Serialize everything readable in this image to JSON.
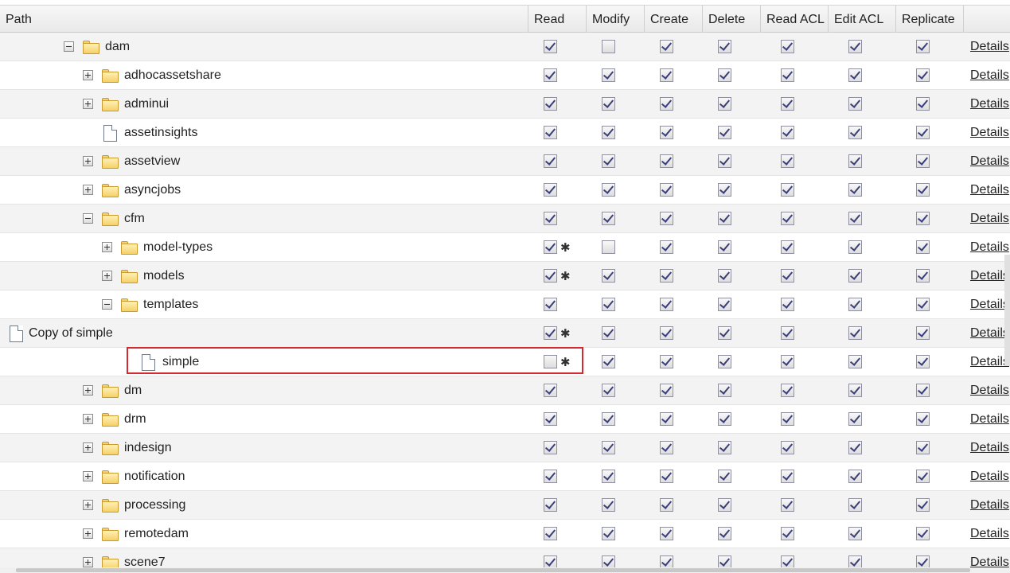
{
  "columns": {
    "path": "Path",
    "read": "Read",
    "modify": "Modify",
    "create": "Create",
    "delete": "Delete",
    "read_acl": "Read ACL",
    "edit_acl": "Edit ACL",
    "replicate": "Replicate"
  },
  "details_label": "Details",
  "highlighted_item": "simple",
  "rows": [
    {
      "name": "dam",
      "type": "folder",
      "expander": "minus",
      "read": true,
      "read_star": false,
      "modify": false,
      "create": true,
      "delete": true,
      "read_acl": true,
      "edit_acl": true,
      "replicate": true
    },
    {
      "name": "adhocassetshare",
      "type": "folder",
      "expander": "plus",
      "read": true,
      "read_star": false,
      "modify": true,
      "create": true,
      "delete": true,
      "read_acl": true,
      "edit_acl": true,
      "replicate": true
    },
    {
      "name": "adminui",
      "type": "folder",
      "expander": "plus",
      "read": true,
      "read_star": false,
      "modify": true,
      "create": true,
      "delete": true,
      "read_acl": true,
      "edit_acl": true,
      "replicate": true
    },
    {
      "name": "assetinsights",
      "type": "file",
      "expander": "none",
      "read": true,
      "read_star": false,
      "modify": true,
      "create": true,
      "delete": true,
      "read_acl": true,
      "edit_acl": true,
      "replicate": true
    },
    {
      "name": "assetview",
      "type": "folder",
      "expander": "plus",
      "read": true,
      "read_star": false,
      "modify": true,
      "create": true,
      "delete": true,
      "read_acl": true,
      "edit_acl": true,
      "replicate": true
    },
    {
      "name": "asyncjobs",
      "type": "folder",
      "expander": "plus",
      "read": true,
      "read_star": false,
      "modify": true,
      "create": true,
      "delete": true,
      "read_acl": true,
      "edit_acl": true,
      "replicate": true
    },
    {
      "name": "cfm",
      "type": "folder",
      "expander": "minus",
      "read": true,
      "read_star": false,
      "modify": true,
      "create": true,
      "delete": true,
      "read_acl": true,
      "edit_acl": true,
      "replicate": true
    },
    {
      "name": "model-types",
      "type": "folder",
      "expander": "plus",
      "read": true,
      "read_star": true,
      "modify": false,
      "create": true,
      "delete": true,
      "read_acl": true,
      "edit_acl": true,
      "replicate": true
    },
    {
      "name": "models",
      "type": "folder",
      "expander": "plus",
      "read": true,
      "read_star": true,
      "modify": true,
      "create": true,
      "delete": true,
      "read_acl": true,
      "edit_acl": true,
      "replicate": true
    },
    {
      "name": "templates",
      "type": "folder",
      "expander": "minus",
      "read": true,
      "read_star": false,
      "modify": true,
      "create": true,
      "delete": true,
      "read_acl": true,
      "edit_acl": true,
      "replicate": true
    },
    {
      "name": "Copy of simple",
      "type": "file",
      "expander": "none",
      "read": true,
      "read_star": true,
      "modify": true,
      "create": true,
      "delete": true,
      "read_acl": true,
      "edit_acl": true,
      "replicate": true
    },
    {
      "name": "simple",
      "type": "file",
      "expander": "none",
      "read": false,
      "read_star": true,
      "modify": true,
      "create": true,
      "delete": true,
      "read_acl": true,
      "edit_acl": true,
      "replicate": true
    },
    {
      "name": "dm",
      "type": "folder",
      "expander": "plus",
      "read": true,
      "read_star": false,
      "modify": true,
      "create": true,
      "delete": true,
      "read_acl": true,
      "edit_acl": true,
      "replicate": true
    },
    {
      "name": "drm",
      "type": "folder",
      "expander": "plus",
      "read": true,
      "read_star": false,
      "modify": true,
      "create": true,
      "delete": true,
      "read_acl": true,
      "edit_acl": true,
      "replicate": true
    },
    {
      "name": "indesign",
      "type": "folder",
      "expander": "plus",
      "read": true,
      "read_star": false,
      "modify": true,
      "create": true,
      "delete": true,
      "read_acl": true,
      "edit_acl": true,
      "replicate": true
    },
    {
      "name": "notification",
      "type": "folder",
      "expander": "plus",
      "read": true,
      "read_star": false,
      "modify": true,
      "create": true,
      "delete": true,
      "read_acl": true,
      "edit_acl": true,
      "replicate": true
    },
    {
      "name": "processing",
      "type": "folder",
      "expander": "plus",
      "read": true,
      "read_star": false,
      "modify": true,
      "create": true,
      "delete": true,
      "read_acl": true,
      "edit_acl": true,
      "replicate": true
    },
    {
      "name": "remotedam",
      "type": "folder",
      "expander": "plus",
      "read": true,
      "read_star": false,
      "modify": true,
      "create": true,
      "delete": true,
      "read_acl": true,
      "edit_acl": true,
      "replicate": true
    },
    {
      "name": "scene7",
      "type": "folder",
      "expander": "plus",
      "read": true,
      "read_star": false,
      "modify": true,
      "create": true,
      "delete": true,
      "read_acl": true,
      "edit_acl": true,
      "replicate": true
    }
  ]
}
